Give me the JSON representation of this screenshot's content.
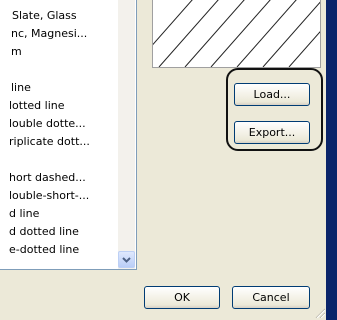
{
  "list": {
    "items": [
      "Slate, Glass",
      "nc, Magnesi...",
      "m",
      "",
      "line",
      "lotted line",
      "louble dotte...",
      "riplicate dott...",
      "",
      "hort dashed...",
      "louble-short-...",
      "d line",
      "d dotted line",
      "e-dotted line"
    ]
  },
  "buttons": {
    "load": "Load...",
    "export": "Export...",
    "ok": "OK",
    "cancel": "Cancel"
  },
  "icons": {
    "scroll_down": "chevron-down-icon",
    "resize": "resize-gripper-icon"
  },
  "colors": {
    "dialog_bg": "#ece9d8",
    "highlight_ring": "#111111",
    "window_frame": "#0a246a"
  }
}
